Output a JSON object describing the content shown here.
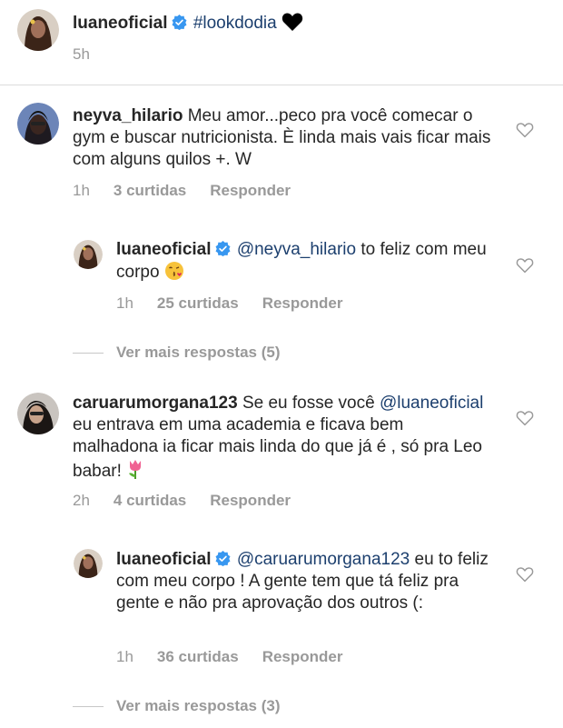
{
  "caption": {
    "username": "luaneoficial",
    "hashtag": "#lookdodia",
    "heart_emoji": "black-heart",
    "time": "5h"
  },
  "comments": [
    {
      "username": "neyva_hilario",
      "text": "Meu amor...peco pra você comecar o gym e buscar nutricionista. È linda mais vais ficar mais com alguns quilos +. W",
      "time": "1h",
      "likes": "3 curtidas",
      "reply_label": "Responder",
      "reply": {
        "username": "luaneoficial",
        "mention": "@neyva_hilario",
        "text": " to feliz com meu corpo",
        "emoji": "kissing-face",
        "time": "1h",
        "likes": "25 curtidas",
        "reply_label": "Responder"
      },
      "more_replies": "Ver mais respostas (5)"
    },
    {
      "username": "caruarumorgana123",
      "text_before": "Se eu fosse você",
      "mention": "@luaneoficial",
      "text_after": "eu entrava em uma academia e ficava bem malhadona ia ficar mais linda do que já é , só pra Leo babar!",
      "emoji": "tulip",
      "time": "2h",
      "likes": "4 curtidas",
      "reply_label": "Responder",
      "reply": {
        "username": "luaneoficial",
        "mention": "@caruarumorgana123",
        "text": " eu to feliz com meu corpo ! A gente tem que tá feliz pra gente e não pra aprovação dos outros (:",
        "time": "1h",
        "likes": "36 curtidas",
        "reply_label": "Responder"
      },
      "more_replies": "Ver mais respostas (3)"
    }
  ],
  "colors": {
    "text": "#262626",
    "muted": "#999999",
    "mention": "#1c3f6e",
    "verified": "#3897f0"
  }
}
